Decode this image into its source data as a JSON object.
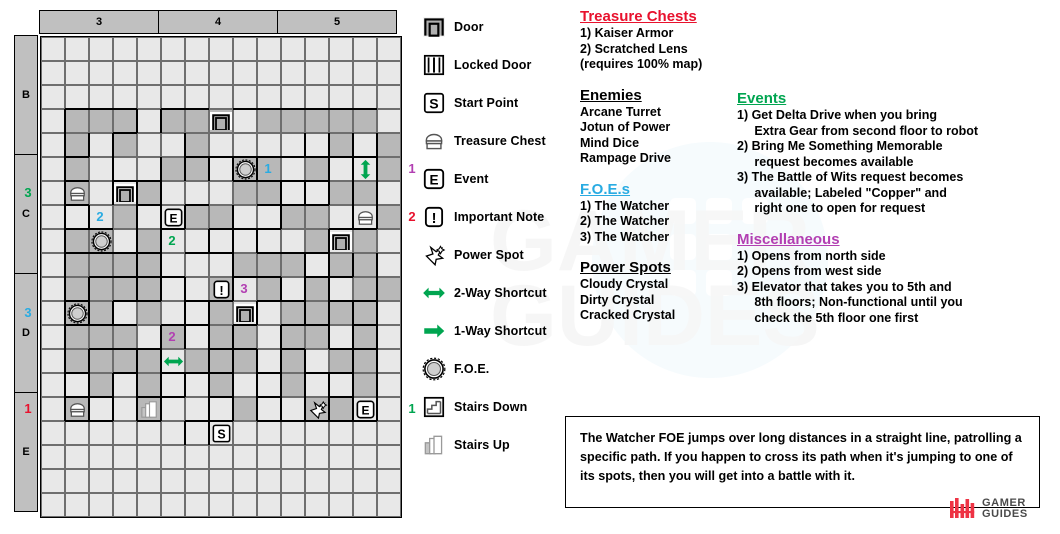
{
  "map": {
    "col_headers": [
      "3",
      "4",
      "5"
    ],
    "row_headers": [
      "B",
      "C",
      "D",
      "E"
    ],
    "cols": 15,
    "rows": 20,
    "markers": [
      {
        "kind": "number",
        "text": "3",
        "color": "#00a550",
        "col": -1,
        "row": 6
      },
      {
        "kind": "number",
        "text": "2",
        "color": "#29abe2",
        "col": 2,
        "row": 7
      },
      {
        "kind": "number",
        "text": "2",
        "color": "#00a550",
        "col": 5,
        "row": 8
      },
      {
        "kind": "number",
        "text": "1",
        "color": "#29abe2",
        "col": 9,
        "row": 5
      },
      {
        "kind": "number",
        "text": "1",
        "color": "#b23fb2",
        "col": 15,
        "row": 5
      },
      {
        "kind": "number",
        "text": "2",
        "color": "#e8112d",
        "col": 15,
        "row": 7
      },
      {
        "kind": "number",
        "text": "3",
        "color": "#b23fb2",
        "col": 8,
        "row": 10
      },
      {
        "kind": "number",
        "text": "3",
        "color": "#29abe2",
        "col": -1,
        "row": 11
      },
      {
        "kind": "number",
        "text": "2",
        "color": "#b23fb2",
        "col": 5,
        "row": 12
      },
      {
        "kind": "number",
        "text": "1",
        "color": "#e8112d",
        "col": -1,
        "row": 15
      },
      {
        "kind": "number",
        "text": "1",
        "color": "#00a550",
        "col": 15,
        "row": 15
      }
    ]
  },
  "legend": [
    {
      "icon": "door-icon",
      "label": "Door"
    },
    {
      "icon": "locked-door-icon",
      "label": "Locked Door"
    },
    {
      "icon": "start-point-icon",
      "label": "Start Point"
    },
    {
      "icon": "treasure-chest-icon",
      "label": "Treasure Chest"
    },
    {
      "icon": "event-icon",
      "label": "Event"
    },
    {
      "icon": "important-note-icon",
      "label": "Important Note"
    },
    {
      "icon": "power-spot-icon",
      "label": "Power Spot"
    },
    {
      "icon": "two-way-shortcut-icon",
      "label": "2-Way Shortcut"
    },
    {
      "icon": "one-way-shortcut-icon",
      "label": "1-Way Shortcut"
    },
    {
      "icon": "foe-icon",
      "label": "F.O.E."
    },
    {
      "icon": "stairs-down-icon",
      "label": "Stairs Down"
    },
    {
      "icon": "stairs-up-icon",
      "label": "Stairs Up"
    }
  ],
  "sections": {
    "treasure_chests": {
      "title": "Treasure Chests",
      "color": "#e8112d",
      "items": [
        "1) Kaiser Armor",
        "2) Scratched Lens (requires 100% map)"
      ]
    },
    "enemies": {
      "title": "Enemies",
      "color": "#000000",
      "items": [
        "Arcane Turret",
        "Jotun of Power",
        "Mind Dice",
        "Rampage Drive"
      ]
    },
    "foes": {
      "title": "F.O.E.s",
      "color": "#29abe2",
      "items": [
        "1) The Watcher",
        "2) The Watcher",
        "3) The Watcher"
      ]
    },
    "power_spots": {
      "title": "Power Spots",
      "color": "#000000",
      "items": [
        "Cloudy Crystal",
        "Dirty Crystal",
        "Cracked Crystal"
      ]
    },
    "events": {
      "title": "Events",
      "color": "#00a550",
      "items": [
        "1) Get Delta Drive when you bring\n     Extra Gear from second floor to robot",
        "2) Bring Me Something Memorable\n     request becomes available",
        "3) The Battle of Wits request becomes\n     available; Labeled \"Copper\" and\n     right one to open for request"
      ]
    },
    "miscellaneous": {
      "title": "Miscellaneous",
      "color": "#b23fb2",
      "items": [
        "1) Opens from north side",
        "2) Opens from west side",
        "3) Elevator that takes you to 5th and\n     8th floors; Non-functional until you\n     check the 5th floor one first"
      ]
    }
  },
  "note_box": {
    "text": "The Watcher FOE jumps over long distances in a straight line, patrolling a specific path. If you happen to cross its path when it's jumping to one of its spots, then you will get into a battle with it."
  },
  "logo": {
    "line1": "GAMER",
    "line2": "GUIDES",
    "mark_color": "#ee3344",
    "text_color": "#4a4a4a"
  }
}
